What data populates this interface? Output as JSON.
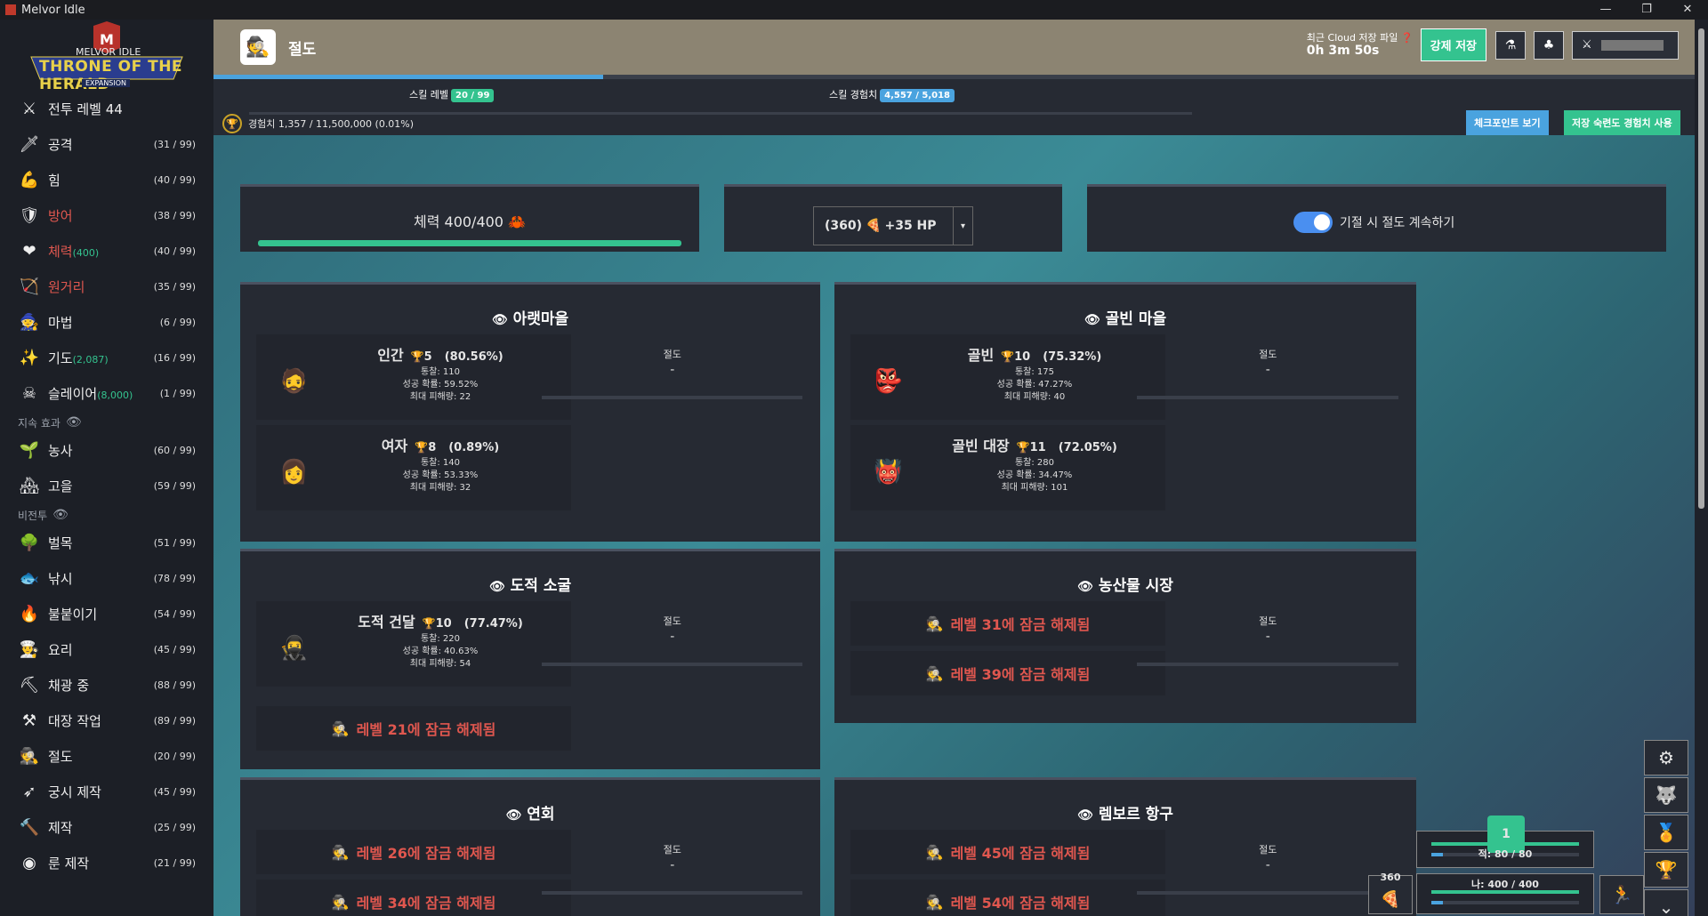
{
  "window": {
    "title": "Melvor Idle"
  },
  "logo": {
    "line1": "MELVOR IDLE",
    "line2": "THRONE OF THE HERALD",
    "line3": "EXPANSION"
  },
  "sidebar": {
    "combat_header": "전투",
    "combat_level": "전투 레벨 44",
    "combat": [
      {
        "name": "공격",
        "level": "(31 / 99)",
        "icon": "sword-icon"
      },
      {
        "name": "힘",
        "level": "(40 / 99)",
        "icon": "strength-arm-icon"
      },
      {
        "name": "방어",
        "level": "(38 / 99)",
        "icon": "shield-icon"
      },
      {
        "name": "체력",
        "extra": "(400)",
        "level": "(40 / 99)",
        "icon": "heart-icon"
      },
      {
        "name": "원거리",
        "level": "(35 / 99)",
        "icon": "bow-icon"
      },
      {
        "name": "마법",
        "level": "(6 / 99)",
        "icon": "wizard-hat-icon"
      },
      {
        "name": "기도",
        "extra": "(2,087)",
        "level": "(16 / 99)",
        "icon": "prayer-sparkle-icon"
      },
      {
        "name": "슬레이어",
        "extra": "(8,000)",
        "level": "(1 / 99)",
        "icon": "slayer-icon"
      }
    ],
    "passive_header": "지속 효과",
    "passive": [
      {
        "name": "농사",
        "level": "(60 / 99)",
        "icon": "sprout-icon"
      },
      {
        "name": "고을",
        "level": "(59 / 99)",
        "icon": "township-icon"
      }
    ],
    "noncombat_header": "비전투",
    "noncombat": [
      {
        "name": "벌목",
        "level": "(51 / 99)",
        "icon": "tree-icon"
      },
      {
        "name": "낚시",
        "level": "(78 / 99)",
        "icon": "fish-icon"
      },
      {
        "name": "불붙이기",
        "level": "(54 / 99)",
        "icon": "fire-icon"
      },
      {
        "name": "요리",
        "level": "(45 / 99)",
        "icon": "chef-hat-icon"
      },
      {
        "name": "채광 중",
        "level": "(88 / 99)",
        "icon": "pickaxe-icon"
      },
      {
        "name": "대장 작업",
        "level": "(89 / 99)",
        "icon": "anvil-icon"
      },
      {
        "name": "절도",
        "level": "(20 / 99)",
        "icon": "thief-icon"
      },
      {
        "name": "궁시 제작",
        "level": "(45 / 99)",
        "icon": "arrow-icon"
      },
      {
        "name": "제작",
        "level": "(25 / 99)",
        "icon": "hammer-icon"
      },
      {
        "name": "룬 제작",
        "level": "(21 / 99)",
        "icon": "rune-icon"
      }
    ]
  },
  "header": {
    "title": "절도",
    "cloud_label": "최근 Cloud 저장 파일",
    "cloud_time": "0h 3m 50s",
    "force_save": "강제 저장"
  },
  "skill": {
    "level_label": "스킬 레벨",
    "level_value": "20 / 99",
    "xp_label": "스킬 경험치",
    "xp_value": "4,557 / 5,018",
    "mastery_text": "경험치 1,357 / 11,500,000 (0.01%)",
    "checkpoint_btn": "체크포인트 보기",
    "mastery_btn": "저장 숙련도 경험치 사용",
    "progress": 0.263
  },
  "top_cards": {
    "hp_label": "체력 400/400",
    "hp_fraction": 1.0,
    "food_count": "(360)",
    "food_heal": "+35 HP",
    "toggle_label": "기절 시 절도 계속하기"
  },
  "areas": [
    {
      "title": "아랫마을",
      "steal_label": "절도",
      "steal_value": "-",
      "npcs": [
        {
          "name": "인간",
          "mastery": "5",
          "pct": "(80.56%)",
          "stat1": "통찰: 110",
          "stat2": "성공 확률: 59.52%",
          "stat3": "최대 피해량: 22",
          "icon": "human-npc-icon"
        },
        {
          "name": "여자",
          "mastery": "8",
          "pct": "(0.89%)",
          "stat1": "통찰: 140",
          "stat2": "성공 확률: 53.33%",
          "stat3": "최대 피해량: 32",
          "icon": "woman-npc-icon"
        }
      ]
    },
    {
      "title": "골빈 마을",
      "steal_label": "절도",
      "steal_value": "-",
      "npcs": [
        {
          "name": "골빈",
          "mastery": "10",
          "pct": "(75.32%)",
          "stat1": "통찰: 175",
          "stat2": "성공 확률: 47.27%",
          "stat3": "최대 피해량: 40",
          "icon": "goblin-npc-icon"
        },
        {
          "name": "골빈 대장",
          "mastery": "11",
          "pct": "(72.05%)",
          "stat1": "통찰: 280",
          "stat2": "성공 확률: 34.47%",
          "stat3": "최대 피해량: 101",
          "icon": "goblin-chief-npc-icon"
        }
      ]
    },
    {
      "title": "도적 소굴",
      "steal_label": "절도",
      "steal_value": "-",
      "npcs": [
        {
          "name": "도적 건달",
          "mastery": "10",
          "pct": "(77.47%)",
          "stat1": "통찰: 220",
          "stat2": "성공 확률: 40.63%",
          "stat3": "최대 피해량: 54",
          "icon": "bandit-npc-icon"
        }
      ],
      "locks": [
        "레벨 21에 잠금 해제됨"
      ]
    },
    {
      "title": "농산물 시장",
      "steal_label": "절도",
      "steal_value": "-",
      "locks": [
        "레벨 31에 잠금 해제됨",
        "레벨 39에 잠금 해제됨"
      ]
    },
    {
      "title": "연회",
      "steal_label": "절도",
      "steal_value": "-",
      "locks": [
        "레벨 26에 잠금 해제됨",
        "레벨 34에 잠금 해제됨"
      ]
    },
    {
      "title": "렘보르 항구",
      "steal_label": "절도",
      "steal_value": "-",
      "locks": [
        "레벨 45에 잠금 해제됨",
        "레벨 54에 잠금 해제됨"
      ]
    }
  ],
  "combat_mini": {
    "badge": "1",
    "enemy_hp": "적: 80 / 80",
    "player_hp": "나: 400 / 400",
    "food_count": "360"
  }
}
